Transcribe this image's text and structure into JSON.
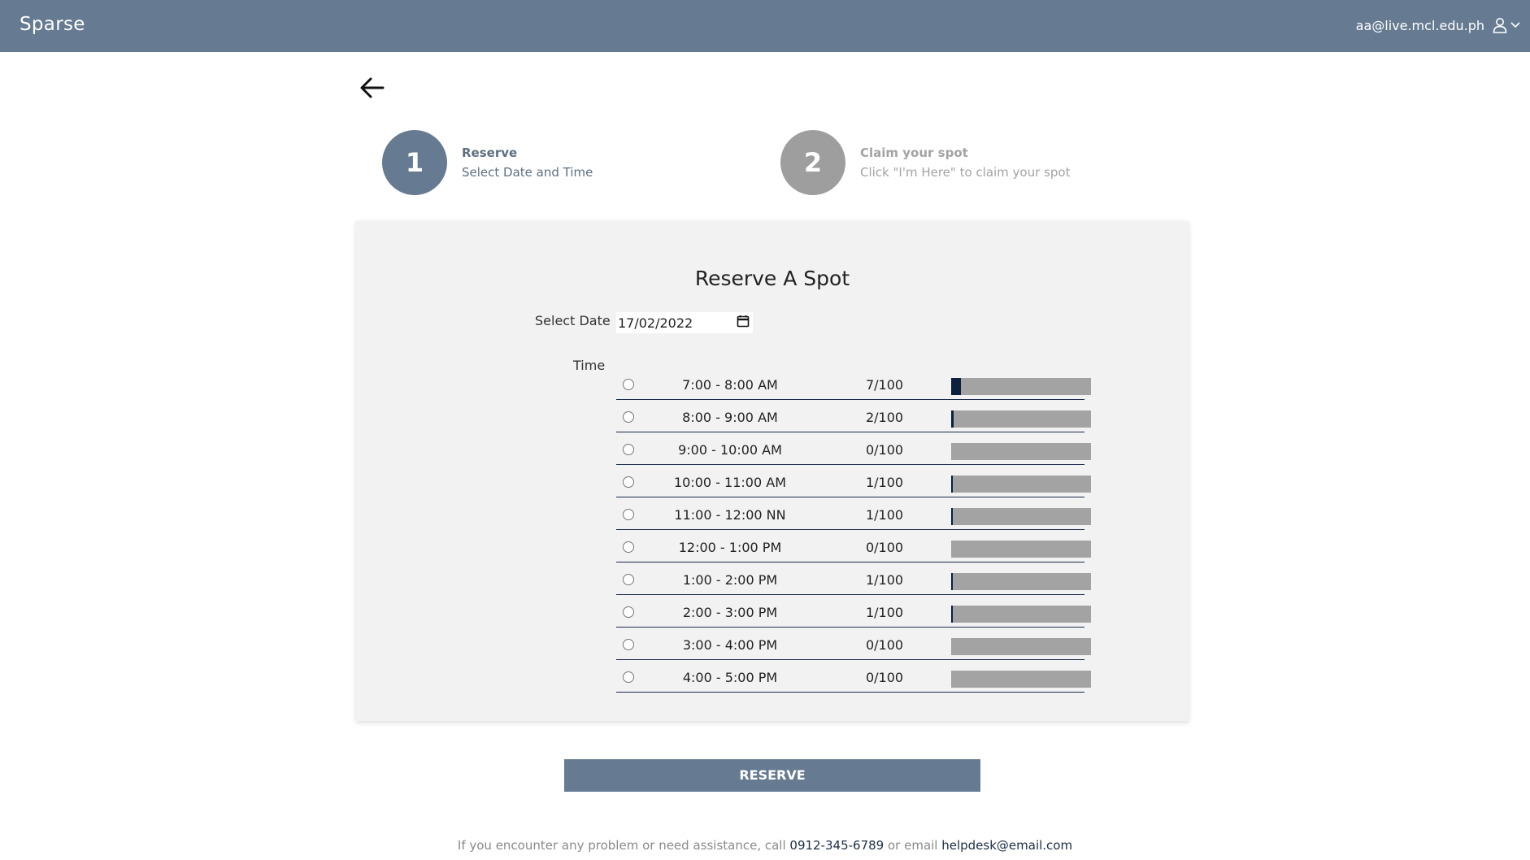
{
  "header": {
    "brand": "Sparse",
    "user_email": "aa@live.mcl.edu.ph",
    "user_icon": "user-icon",
    "menu_icon": "chevron-down-icon"
  },
  "back_icon": "arrow-left-icon",
  "steps": [
    {
      "number": "1",
      "title": "Reserve",
      "subtitle": "Select Date and Time"
    },
    {
      "number": "2",
      "title": "Claim your spot",
      "subtitle": "Click \"I'm Here\" to claim your spot"
    }
  ],
  "reserve": {
    "title": "Reserve A Spot",
    "date_label": "Select Date",
    "date_value": "17/02/2022",
    "time_label": "Time",
    "slots": [
      {
        "time": "7:00 - 8:00 AM",
        "count": "7/100",
        "fill": 7
      },
      {
        "time": "8:00 - 9:00 AM",
        "count": "2/100",
        "fill": 2
      },
      {
        "time": "9:00 - 10:00 AM",
        "count": "0/100",
        "fill": 0
      },
      {
        "time": "10:00 - 11:00 AM",
        "count": "1/100",
        "fill": 1
      },
      {
        "time": "11:00 - 12:00 NN",
        "count": "1/100",
        "fill": 1
      },
      {
        "time": "12:00 - 1:00 PM",
        "count": "0/100",
        "fill": 0
      },
      {
        "time": "1:00 - 2:00 PM",
        "count": "1/100",
        "fill": 1
      },
      {
        "time": "2:00 - 3:00 PM",
        "count": "1/100",
        "fill": 1
      },
      {
        "time": "3:00 - 4:00 PM",
        "count": "0/100",
        "fill": 0
      },
      {
        "time": "4:00 - 5:00 PM",
        "count": "0/100",
        "fill": 0
      }
    ],
    "button_label": "RESERVE"
  },
  "footer": {
    "text_before": "If you encounter any problem or need assistance, call ",
    "phone": "0912-345-6789",
    "text_middle": " or email ",
    "email": "helpdesk@email.com"
  },
  "colors": {
    "header_bg": "#667b92",
    "active_step": "#667b92",
    "inactive_step": "#9e9e9e",
    "bar_fill": "#0c2040",
    "bar_bg": "#a3a3a3"
  }
}
